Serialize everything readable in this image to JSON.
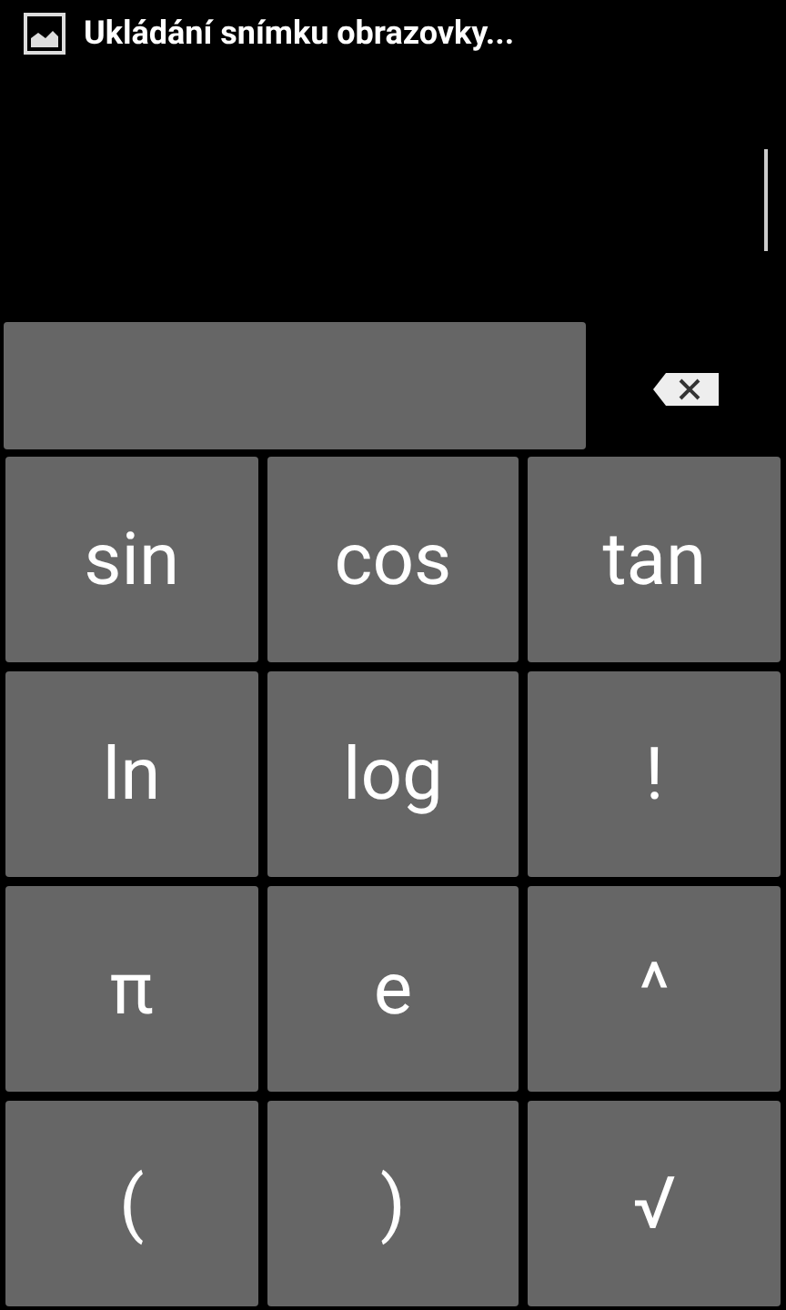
{
  "status_bar": {
    "notification": "Ukládání snímku obrazovky..."
  },
  "keys": [
    {
      "label": "sin"
    },
    {
      "label": "cos"
    },
    {
      "label": "tan"
    },
    {
      "label": "ln"
    },
    {
      "label": "log"
    },
    {
      "label": "!"
    },
    {
      "label": "π"
    },
    {
      "label": "e"
    },
    {
      "label": "^"
    },
    {
      "label": "("
    },
    {
      "label": ")"
    },
    {
      "label": "√"
    }
  ]
}
